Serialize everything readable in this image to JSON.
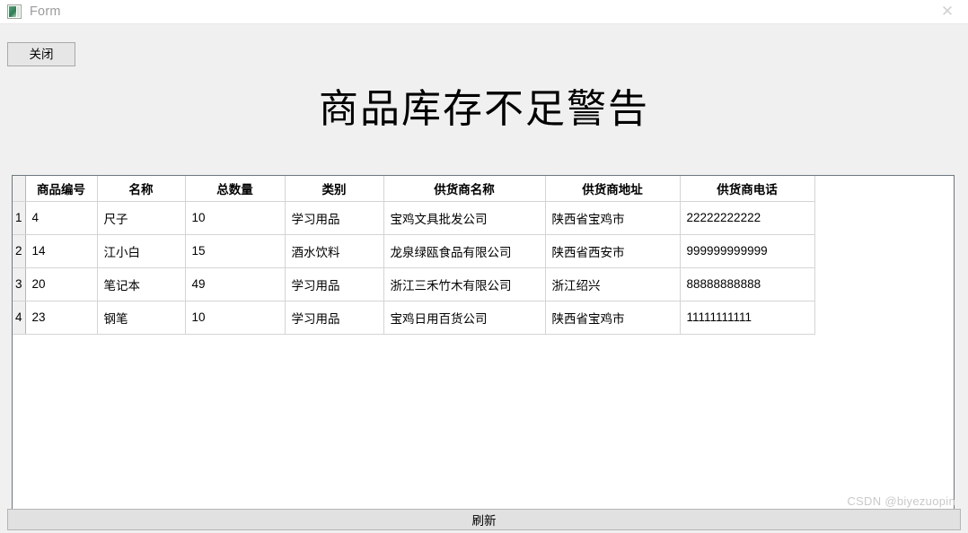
{
  "window": {
    "title": "Form",
    "icon": "form-app-icon",
    "close_glyph": "✕"
  },
  "toolbar": {
    "close_label": "关闭"
  },
  "page_title": "商品库存不足警告",
  "grid": {
    "columns": [
      "商品编号",
      "名称",
      "总数量",
      "类别",
      "供货商名称",
      "供货商地址",
      "供货商电话"
    ],
    "rows": [
      {
        "index": "1",
        "cells": [
          "4",
          "尺子",
          "10",
          "学习用品",
          "宝鸡文具批发公司",
          "陕西省宝鸡市",
          "22222222222"
        ]
      },
      {
        "index": "2",
        "cells": [
          "14",
          "江小白",
          "15",
          "酒水饮料",
          "龙泉绿瓯食品有限公司",
          "陕西省西安市",
          "999999999999"
        ]
      },
      {
        "index": "3",
        "cells": [
          "20",
          "笔记本",
          "49",
          "学习用品",
          "浙江三禾竹木有限公司",
          "浙江绍兴",
          "88888888888"
        ]
      },
      {
        "index": "4",
        "cells": [
          "23",
          "钢笔",
          "10",
          "学习用品",
          "宝鸡日用百货公司",
          "陕西省宝鸡市",
          "11111111111"
        ]
      }
    ]
  },
  "status_bar": {
    "refresh_label": "刷新"
  },
  "watermark": "CSDN @biyezuopin",
  "colors": {
    "window_bg": "#f0f0f0",
    "grid_border": "#6e7781",
    "cell_border": "#d4d4d4",
    "status_bg": "#e1e1e1",
    "watermark": "#c9c9c9"
  }
}
